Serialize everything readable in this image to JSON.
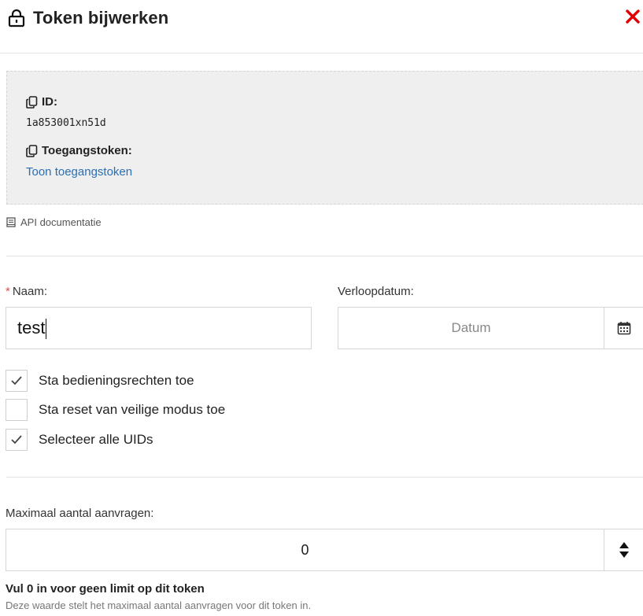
{
  "header": {
    "title": "Token bijwerken",
    "lock_icon": "lock-icon",
    "close_icon": "close-icon",
    "close_color": "#e00000"
  },
  "info": {
    "id_label": "ID:",
    "id_value": "1a853001xn51d",
    "token_label": "Toegangstoken:",
    "token_link": "Toon toegangstoken",
    "copy_icon": "copy-icon",
    "link_color": "#2a6fb5"
  },
  "api_doc": {
    "label": "API documentatie",
    "icon": "book-icon"
  },
  "form": {
    "name_required_mark": "*",
    "name_label": "Naam:",
    "name_value": "test",
    "expiry_label": "Verloopdatum:",
    "expiry_placeholder": "Datum",
    "calendar_icon": "calendar-icon",
    "checkboxes": [
      {
        "label": "Sta bedieningsrechten toe",
        "checked": true
      },
      {
        "label": "Sta reset van veilige modus toe",
        "checked": false
      },
      {
        "label": "Selecteer alle UIDs",
        "checked": true
      }
    ],
    "max_requests_label": "Maximaal aantal aanvragen:",
    "max_requests_value": "0",
    "stepper_icon": "sort-icon",
    "hint_title": "Vul 0 in voor geen limit op dit token",
    "hint_text": "Deze waarde stelt het maximaal aantal aanvragen voor dit token in."
  }
}
